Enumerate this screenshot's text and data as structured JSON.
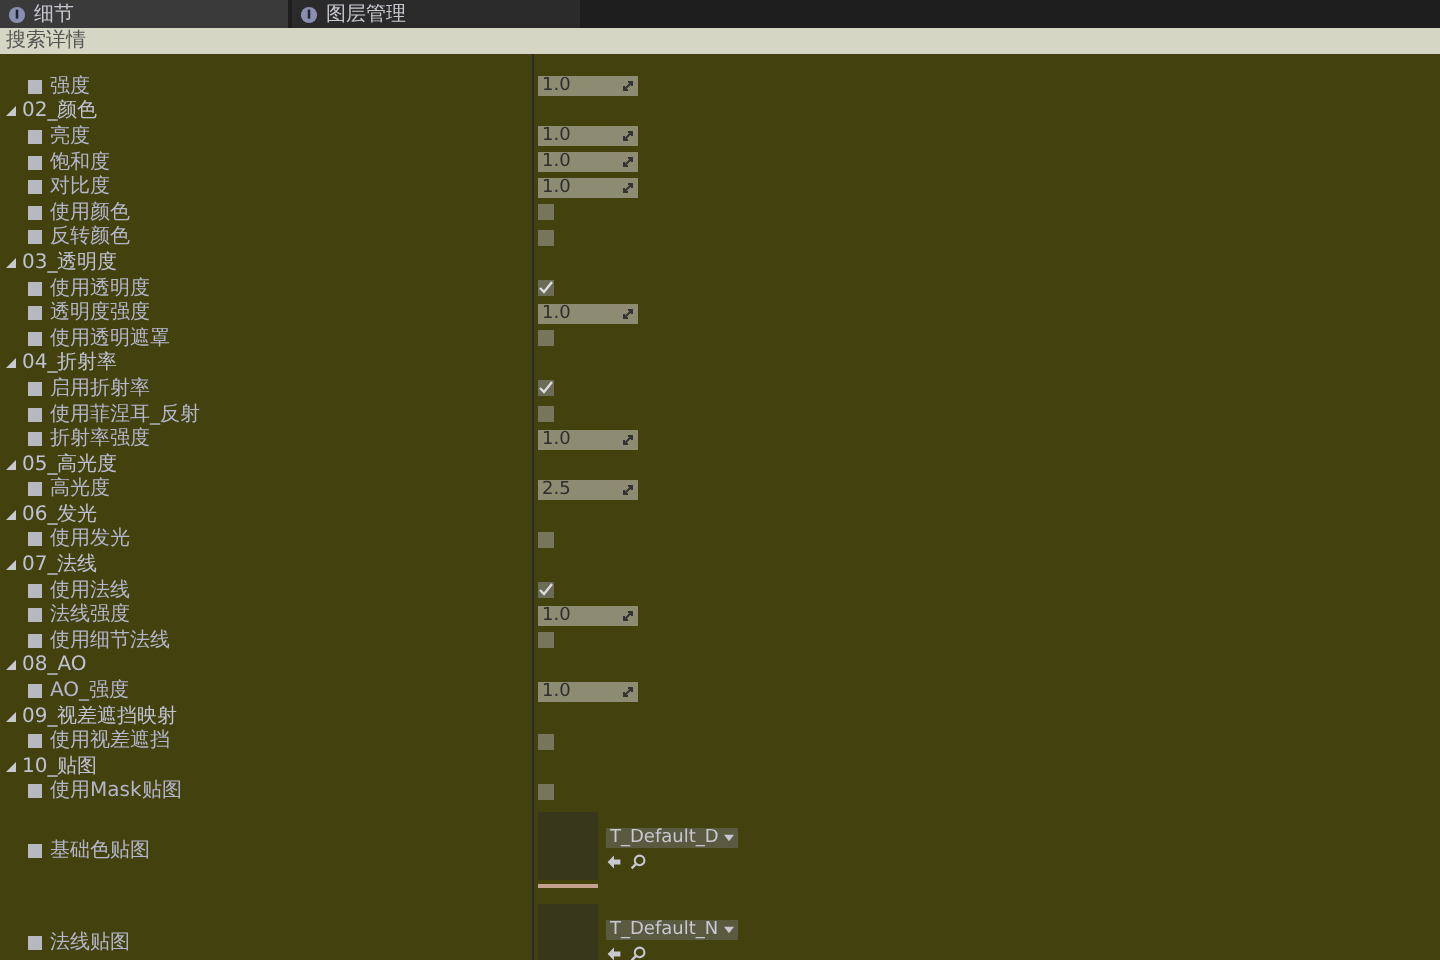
{
  "tabs": [
    {
      "label": "细节",
      "selected": true
    },
    {
      "label": "图层管理",
      "selected": false
    }
  ],
  "search": {
    "placeholder": "搜索详情"
  },
  "properties": [
    {
      "label": "强度",
      "kind": "number",
      "value": "1.0"
    }
  ],
  "groups": [
    {
      "title": "02_颜色",
      "expanded": true,
      "properties": [
        {
          "label": "亮度",
          "kind": "number",
          "value": "1.0"
        },
        {
          "label": "饱和度",
          "kind": "number",
          "value": "1.0"
        },
        {
          "label": "对比度",
          "kind": "number",
          "value": "1.0"
        },
        {
          "label": "使用颜色",
          "kind": "checkbox",
          "checked": false
        },
        {
          "label": "反转颜色",
          "kind": "checkbox",
          "checked": false
        }
      ]
    },
    {
      "title": "03_透明度",
      "expanded": true,
      "properties": [
        {
          "label": "使用透明度",
          "kind": "checkbox",
          "checked": true
        },
        {
          "label": "透明度强度",
          "kind": "number",
          "value": "1.0"
        },
        {
          "label": "使用透明遮罩",
          "kind": "checkbox",
          "checked": false
        }
      ]
    },
    {
      "title": "04_折射率",
      "expanded": true,
      "properties": [
        {
          "label": "启用折射率",
          "kind": "checkbox",
          "checked": true
        },
        {
          "label": "使用菲涅耳_反射",
          "kind": "checkbox",
          "checked": false
        },
        {
          "label": "折射率强度",
          "kind": "number",
          "value": "1.0"
        }
      ]
    },
    {
      "title": "05_高光度",
      "expanded": true,
      "properties": [
        {
          "label": "高光度",
          "kind": "number",
          "value": "2.5"
        }
      ]
    },
    {
      "title": "06_发光",
      "expanded": true,
      "properties": [
        {
          "label": "使用发光",
          "kind": "checkbox",
          "checked": false
        }
      ]
    },
    {
      "title": "07_法线",
      "expanded": true,
      "properties": [
        {
          "label": "使用法线",
          "kind": "checkbox",
          "checked": true
        },
        {
          "label": "法线强度",
          "kind": "number",
          "value": "1.0"
        },
        {
          "label": "使用细节法线",
          "kind": "checkbox",
          "checked": false
        }
      ]
    },
    {
      "title": "08_AO",
      "expanded": true,
      "properties": [
        {
          "label": "AO_强度",
          "kind": "number",
          "value": "1.0"
        }
      ]
    },
    {
      "title": "09_视差遮挡映射",
      "expanded": true,
      "properties": [
        {
          "label": "使用视差遮挡",
          "kind": "checkbox",
          "checked": false
        }
      ]
    },
    {
      "title": "10_贴图",
      "expanded": true,
      "properties": [
        {
          "label": "使用Mask贴图",
          "kind": "checkbox",
          "checked": false
        },
        {
          "label": "基础色贴图",
          "kind": "texture",
          "asset": "T_Default_D"
        },
        {
          "label": "法线贴图",
          "kind": "texture",
          "asset": "T_Default_N"
        }
      ]
    }
  ]
}
